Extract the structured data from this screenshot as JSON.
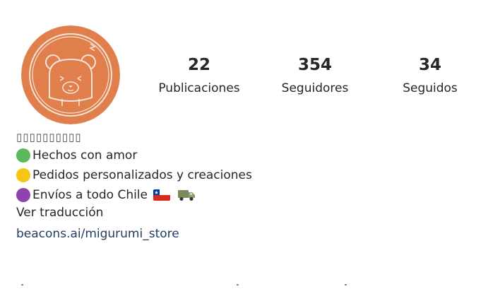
{
  "profile": {
    "avatar_icon": "bear-logo-icon",
    "avatar_color": "#e07f4c"
  },
  "stats": {
    "posts_count": "22",
    "posts_label": "Publicaciones",
    "followers_count": "354",
    "followers_label": "Seguidores",
    "following_count": "34",
    "following_label": "Seguidos"
  },
  "bio": {
    "name": "▯▯▯▯▯▯▯▯▯▯",
    "line1": "Hechos con amor",
    "line2": "Pedidos personalizados y creaciones",
    "line3": "Envíos a todo Chile",
    "translate": "Ver traducción",
    "link": "beacons.ai/migurumi_store"
  },
  "icons": {
    "bullet1": "green-circle-icon",
    "bullet2": "yellow-circle-icon",
    "bullet3": "purple-circle-icon",
    "flag": "chile-flag-icon",
    "truck": "delivery-truck-icon"
  }
}
